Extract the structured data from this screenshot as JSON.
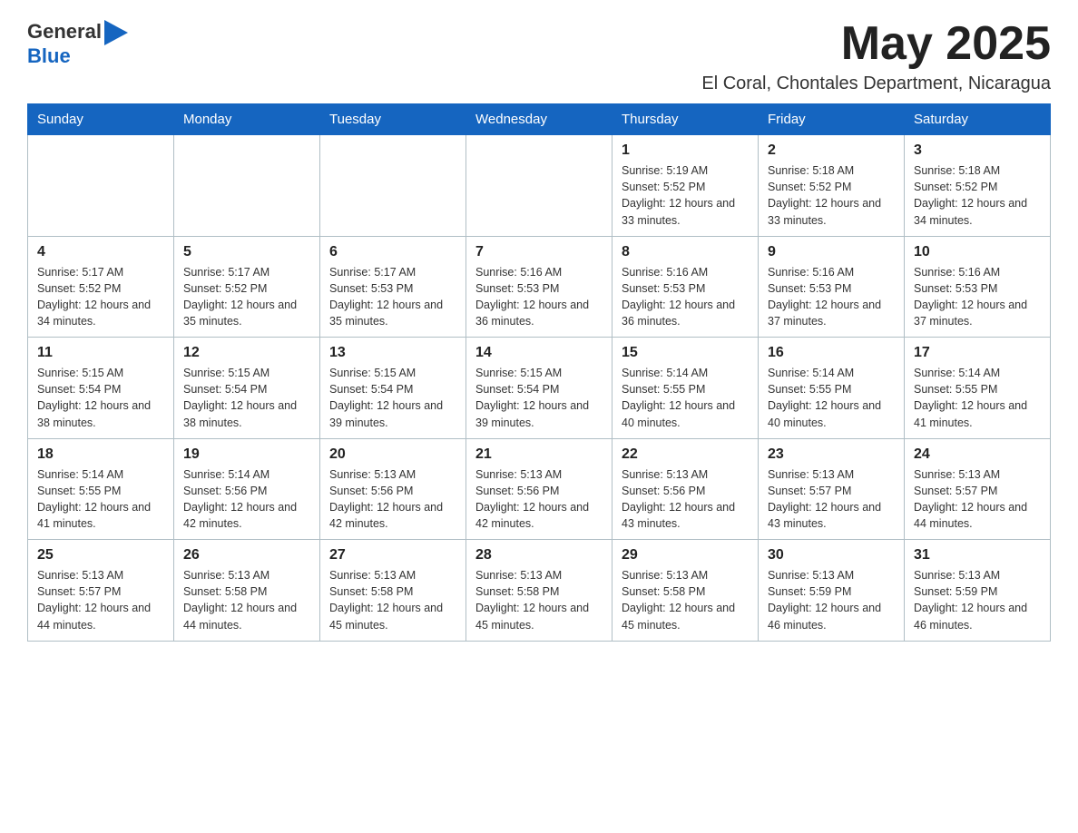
{
  "header": {
    "logo": {
      "text_general": "General",
      "text_blue": "Blue"
    },
    "month_title": "May 2025",
    "location": "El Coral, Chontales Department, Nicaragua"
  },
  "calendar": {
    "weekdays": [
      "Sunday",
      "Monday",
      "Tuesday",
      "Wednesday",
      "Thursday",
      "Friday",
      "Saturday"
    ],
    "weeks": [
      [
        {
          "day": "",
          "info": ""
        },
        {
          "day": "",
          "info": ""
        },
        {
          "day": "",
          "info": ""
        },
        {
          "day": "",
          "info": ""
        },
        {
          "day": "1",
          "info": "Sunrise: 5:19 AM\nSunset: 5:52 PM\nDaylight: 12 hours and 33 minutes."
        },
        {
          "day": "2",
          "info": "Sunrise: 5:18 AM\nSunset: 5:52 PM\nDaylight: 12 hours and 33 minutes."
        },
        {
          "day": "3",
          "info": "Sunrise: 5:18 AM\nSunset: 5:52 PM\nDaylight: 12 hours and 34 minutes."
        }
      ],
      [
        {
          "day": "4",
          "info": "Sunrise: 5:17 AM\nSunset: 5:52 PM\nDaylight: 12 hours and 34 minutes."
        },
        {
          "day": "5",
          "info": "Sunrise: 5:17 AM\nSunset: 5:52 PM\nDaylight: 12 hours and 35 minutes."
        },
        {
          "day": "6",
          "info": "Sunrise: 5:17 AM\nSunset: 5:53 PM\nDaylight: 12 hours and 35 minutes."
        },
        {
          "day": "7",
          "info": "Sunrise: 5:16 AM\nSunset: 5:53 PM\nDaylight: 12 hours and 36 minutes."
        },
        {
          "day": "8",
          "info": "Sunrise: 5:16 AM\nSunset: 5:53 PM\nDaylight: 12 hours and 36 minutes."
        },
        {
          "day": "9",
          "info": "Sunrise: 5:16 AM\nSunset: 5:53 PM\nDaylight: 12 hours and 37 minutes."
        },
        {
          "day": "10",
          "info": "Sunrise: 5:16 AM\nSunset: 5:53 PM\nDaylight: 12 hours and 37 minutes."
        }
      ],
      [
        {
          "day": "11",
          "info": "Sunrise: 5:15 AM\nSunset: 5:54 PM\nDaylight: 12 hours and 38 minutes."
        },
        {
          "day": "12",
          "info": "Sunrise: 5:15 AM\nSunset: 5:54 PM\nDaylight: 12 hours and 38 minutes."
        },
        {
          "day": "13",
          "info": "Sunrise: 5:15 AM\nSunset: 5:54 PM\nDaylight: 12 hours and 39 minutes."
        },
        {
          "day": "14",
          "info": "Sunrise: 5:15 AM\nSunset: 5:54 PM\nDaylight: 12 hours and 39 minutes."
        },
        {
          "day": "15",
          "info": "Sunrise: 5:14 AM\nSunset: 5:55 PM\nDaylight: 12 hours and 40 minutes."
        },
        {
          "day": "16",
          "info": "Sunrise: 5:14 AM\nSunset: 5:55 PM\nDaylight: 12 hours and 40 minutes."
        },
        {
          "day": "17",
          "info": "Sunrise: 5:14 AM\nSunset: 5:55 PM\nDaylight: 12 hours and 41 minutes."
        }
      ],
      [
        {
          "day": "18",
          "info": "Sunrise: 5:14 AM\nSunset: 5:55 PM\nDaylight: 12 hours and 41 minutes."
        },
        {
          "day": "19",
          "info": "Sunrise: 5:14 AM\nSunset: 5:56 PM\nDaylight: 12 hours and 42 minutes."
        },
        {
          "day": "20",
          "info": "Sunrise: 5:13 AM\nSunset: 5:56 PM\nDaylight: 12 hours and 42 minutes."
        },
        {
          "day": "21",
          "info": "Sunrise: 5:13 AM\nSunset: 5:56 PM\nDaylight: 12 hours and 42 minutes."
        },
        {
          "day": "22",
          "info": "Sunrise: 5:13 AM\nSunset: 5:56 PM\nDaylight: 12 hours and 43 minutes."
        },
        {
          "day": "23",
          "info": "Sunrise: 5:13 AM\nSunset: 5:57 PM\nDaylight: 12 hours and 43 minutes."
        },
        {
          "day": "24",
          "info": "Sunrise: 5:13 AM\nSunset: 5:57 PM\nDaylight: 12 hours and 44 minutes."
        }
      ],
      [
        {
          "day": "25",
          "info": "Sunrise: 5:13 AM\nSunset: 5:57 PM\nDaylight: 12 hours and 44 minutes."
        },
        {
          "day": "26",
          "info": "Sunrise: 5:13 AM\nSunset: 5:58 PM\nDaylight: 12 hours and 44 minutes."
        },
        {
          "day": "27",
          "info": "Sunrise: 5:13 AM\nSunset: 5:58 PM\nDaylight: 12 hours and 45 minutes."
        },
        {
          "day": "28",
          "info": "Sunrise: 5:13 AM\nSunset: 5:58 PM\nDaylight: 12 hours and 45 minutes."
        },
        {
          "day": "29",
          "info": "Sunrise: 5:13 AM\nSunset: 5:58 PM\nDaylight: 12 hours and 45 minutes."
        },
        {
          "day": "30",
          "info": "Sunrise: 5:13 AM\nSunset: 5:59 PM\nDaylight: 12 hours and 46 minutes."
        },
        {
          "day": "31",
          "info": "Sunrise: 5:13 AM\nSunset: 5:59 PM\nDaylight: 12 hours and 46 minutes."
        }
      ]
    ]
  }
}
